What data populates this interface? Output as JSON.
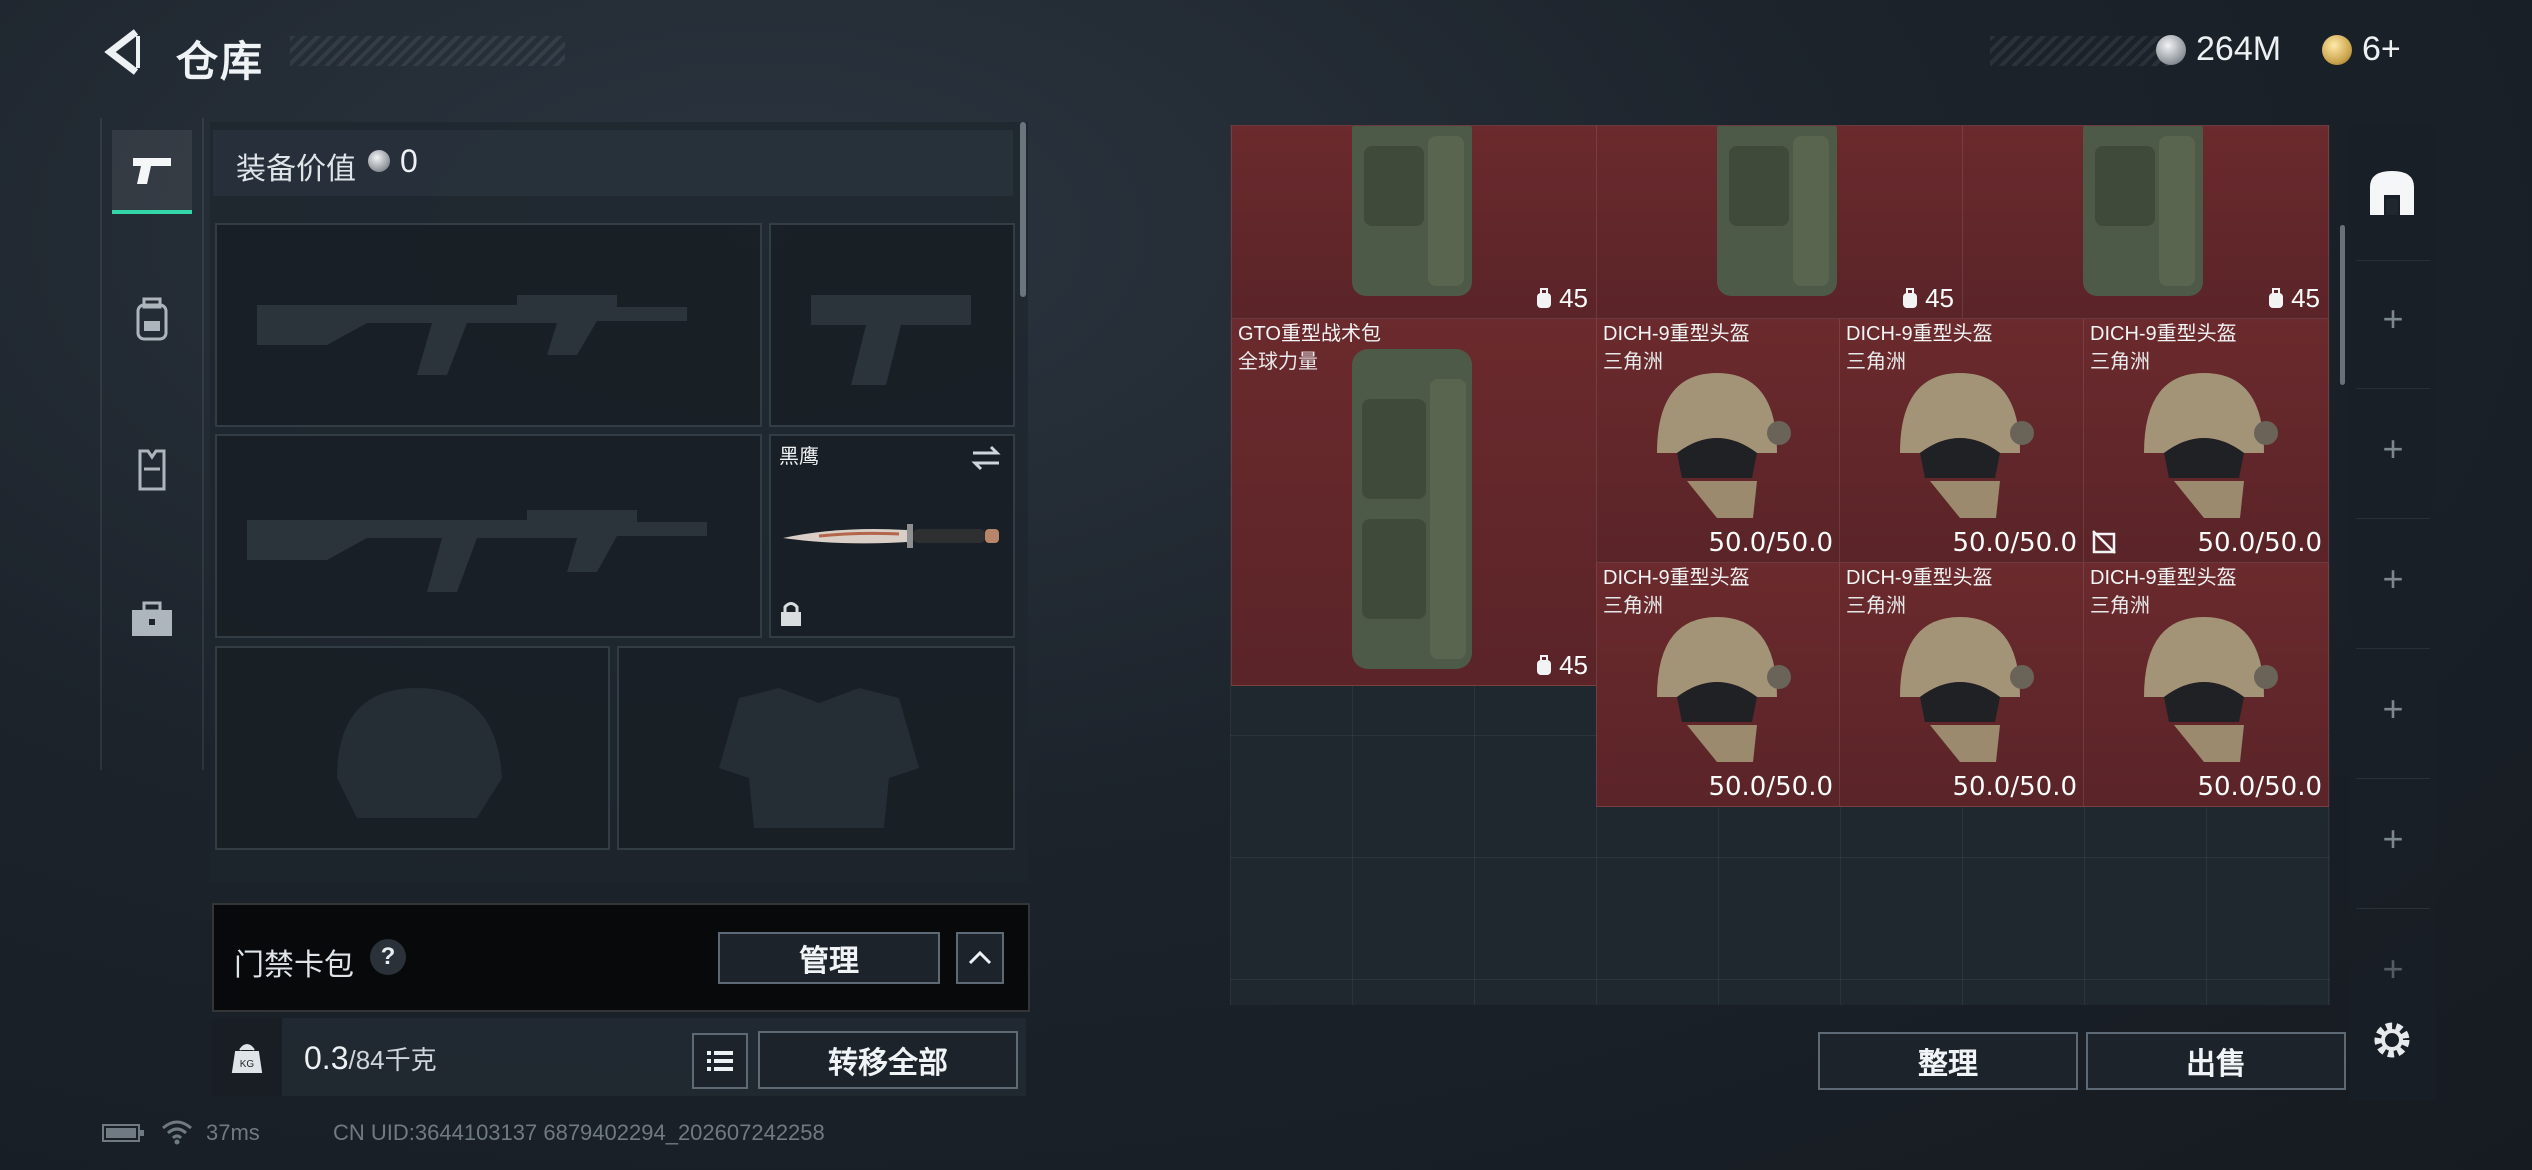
{
  "header": {
    "title": "仓库",
    "currency_silver": "264M",
    "currency_gold": "6+"
  },
  "tabs": [
    {
      "name": "weapons",
      "icon": "pistol-icon",
      "active": true
    },
    {
      "name": "gear",
      "icon": "backpack-icon",
      "active": false
    },
    {
      "name": "armor",
      "icon": "vest-icon",
      "active": false
    },
    {
      "name": "items",
      "icon": "briefcase-icon",
      "active": false
    }
  ],
  "equipment": {
    "value_label": "装备价值",
    "value": "0",
    "melee_name": "黑鹰"
  },
  "keycard": {
    "label": "门禁卡包",
    "help": "?",
    "manage_label": "管理"
  },
  "weight": {
    "current": "0.3",
    "max": "/84千克",
    "kg_icon_text": "KG",
    "transfer_all": "转移全部"
  },
  "status": {
    "ping": "37ms",
    "uid": "CN UID:3644103137 6879402294_202607242258"
  },
  "storage": {
    "backpack_top_capacity": [
      "45",
      "45",
      "45"
    ],
    "backpack": {
      "name": "GTO重型战术包",
      "sub": "全球力量",
      "capacity": "45"
    },
    "helmets": [
      {
        "name": "DICH-9重型头盔",
        "sub": "三角洲",
        "durability": "50.0/50.0"
      },
      {
        "name": "DICH-9重型头盔",
        "sub": "三角洲",
        "durability": "50.0/50.0"
      },
      {
        "name": "DICH-9重型头盔",
        "sub": "三角洲",
        "durability": "50.0/50.0"
      },
      {
        "name": "DICH-9重型头盔",
        "sub": "三角洲",
        "durability": "50.0/50.0"
      },
      {
        "name": "DICH-9重型头盔",
        "sub": "三角洲",
        "durability": "50.0/50.0"
      },
      {
        "name": "DICH-9重型头盔",
        "sub": "三角洲",
        "durability": "50.0/50.0"
      }
    ],
    "sort_label": "整理",
    "sell_label": "出售"
  },
  "colors": {
    "accent": "#33d6a8",
    "item_red": "#6b2a2d"
  }
}
